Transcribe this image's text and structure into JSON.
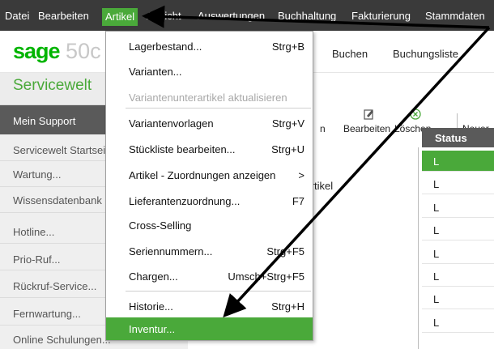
{
  "menubar": {
    "items": [
      "Datei",
      "Bearbeiten",
      "Artikel",
      "Ansicht",
      "Auswertungen",
      "Buchhaltung",
      "Fakturierung",
      "Stammdaten"
    ]
  },
  "brand": {
    "logo_main": "sage",
    "logo_suffix": " 50c",
    "tabs": [
      "Buchen",
      "Buchungsliste"
    ]
  },
  "sidebar": {
    "title": "Servicewelt",
    "selected": "Mein Support",
    "items": [
      "Servicewelt Startseite",
      "Wartung...",
      "Wissensdatenbank",
      "Hotline...",
      "Prio-Ruf...",
      "Rückruf-Service...",
      "Fernwartung...",
      "Online Schulungen..."
    ]
  },
  "toolbar": {
    "edit_label": "Bearbeiten",
    "delete_label": "Löschen",
    "new_label": "Neuer",
    "left_cut_label": "n"
  },
  "content": {
    "label": "Artikel"
  },
  "grid": {
    "header": "Status",
    "rows": [
      "L",
      "L",
      "L",
      "L",
      "L",
      "L",
      "L",
      "L"
    ]
  },
  "dropdown": {
    "items": [
      {
        "label": "Lagerbestand...",
        "shortcut": "Strg+B"
      },
      {
        "label": "Varianten...",
        "shortcut": ""
      },
      {
        "label": "Variantenunterartikel aktualisieren",
        "shortcut": ""
      },
      {
        "label": "Variantenvorlagen",
        "shortcut": "Strg+V"
      },
      {
        "label": "Stückliste bearbeiten...",
        "shortcut": "Strg+U"
      },
      {
        "label": "Artikel - Zuordnungen anzeigen",
        "shortcut": ">"
      },
      {
        "label": "Lieferantenzuordnung...",
        "shortcut": "F7"
      },
      {
        "label": "Cross-Selling",
        "shortcut": ""
      },
      {
        "label": "Seriennummern...",
        "shortcut": "Strg+F5"
      },
      {
        "label": "Chargen...",
        "shortcut": "Umsch+Strg+F5"
      },
      {
        "label": "Historie...",
        "shortcut": "Strg+H"
      },
      {
        "label": "Inventur...",
        "shortcut": ""
      }
    ]
  },
  "colors": {
    "accent": "#4aa93a",
    "menubar_bg": "#3a3a3a",
    "logo": "#00b400"
  }
}
